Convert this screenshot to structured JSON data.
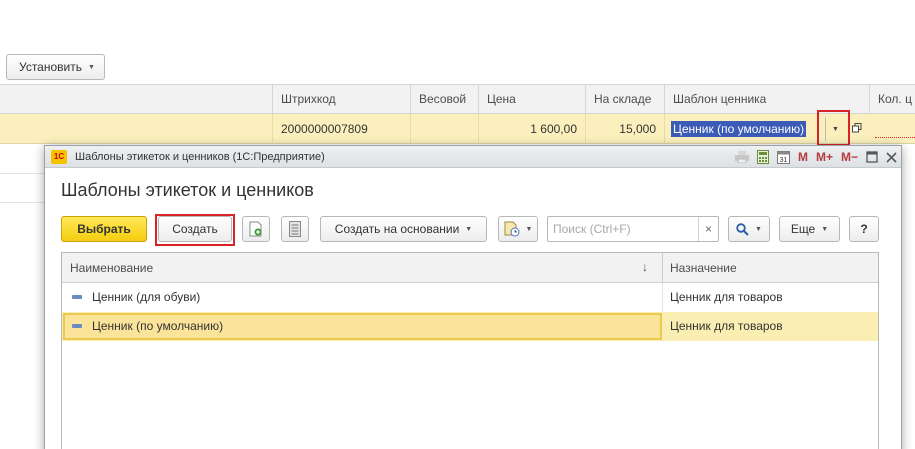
{
  "background": {
    "set_button": "Установить",
    "columns": [
      "Штрихкод",
      "Весовой",
      "Цена",
      "На складе",
      "Шаблон ценника",
      "Кол. ц"
    ],
    "row": {
      "barcode": "2000000007809",
      "weighted": "",
      "price": "1 600,00",
      "stock": "15,000",
      "template": "Ценник (по умолчанию)"
    }
  },
  "window": {
    "title": "Шаблоны этикеток и ценников  (1С:Предприятие)",
    "logo": "1С",
    "titlebar_icons": [
      "print-icon",
      "calculator-icon",
      "calendar-icon",
      "M",
      "M+",
      "M−",
      "minimize-icon",
      "close-icon"
    ],
    "heading": "Шаблоны этикеток и ценников",
    "toolbar": {
      "select": "Выбрать",
      "create": "Создать",
      "create_based_on": "Создать на основании",
      "search_placeholder": "Поиск (Ctrl+F)",
      "more": "Еще",
      "help": "?"
    },
    "table": {
      "col_name": "Наименование",
      "col_purpose": "Назначение",
      "rows": [
        {
          "name": "Ценник (для обуви)",
          "purpose": "Ценник для товаров",
          "selected": false
        },
        {
          "name": "Ценник (по умолчанию)",
          "purpose": "Ценник для товаров",
          "selected": true
        }
      ]
    }
  },
  "colors": {
    "accent_yellow": "#f5cd10",
    "selection_row": "#fbeeb3",
    "highlight_red": "#d9232a",
    "selected_text_bg": "#3a5bb8"
  }
}
